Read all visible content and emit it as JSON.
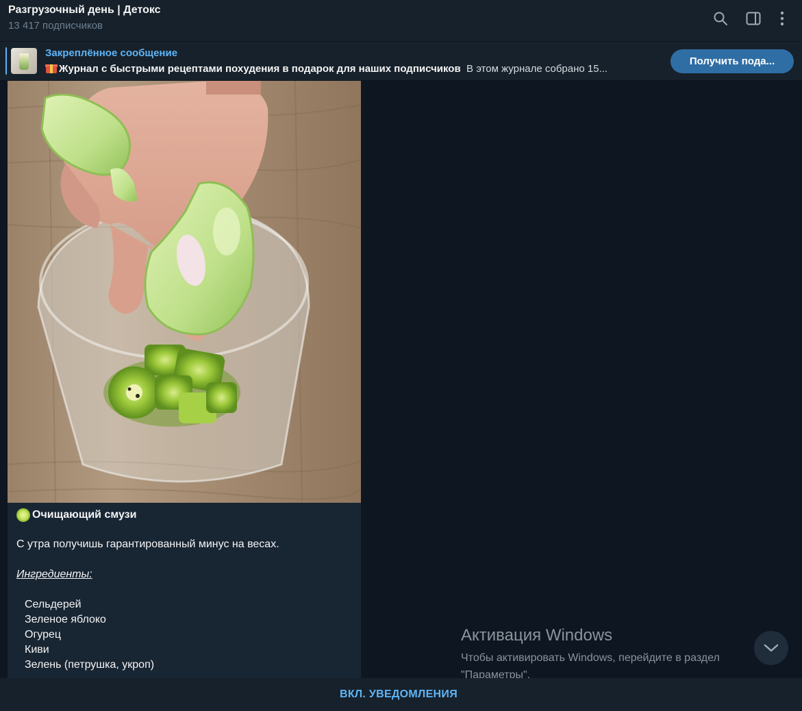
{
  "header": {
    "title": "Разгрузочный день | Детокс",
    "subscribers": "13 417 подписчиков",
    "icons": [
      "search-icon",
      "sidebar-toggle-icon",
      "more-vert-icon"
    ]
  },
  "pinned": {
    "label": "Закреплённое сообщение",
    "text_bold": "Журнал с быстрыми рецептами похудения в подарок для наших подписчиков",
    "text_rest": "В этом журнале собрано 15...",
    "button_label": "Получить пода..."
  },
  "message": {
    "title": "Очищающий смузи",
    "intro": "С утра получишь гарантированный минус на весах.",
    "ingredients_heading": "Ингредиенты:",
    "ingredients": [
      "Сельдерей",
      "Зеленое яблоко",
      "Огурец",
      "Киви",
      "Зелень (петрушка, укроп)"
    ]
  },
  "watermark": {
    "title": "Активация Windows",
    "text": "Чтобы активировать Windows, перейдите в раздел \"Параметры\"."
  },
  "bottom": {
    "notify_label": "ВКЛ. УВЕДОМЛЕНИЯ"
  },
  "colors": {
    "background": "#0e1621",
    "panel": "#17212b",
    "bubble": "#182533",
    "accent": "#5eb5f7",
    "button": "#2f6ea5"
  }
}
